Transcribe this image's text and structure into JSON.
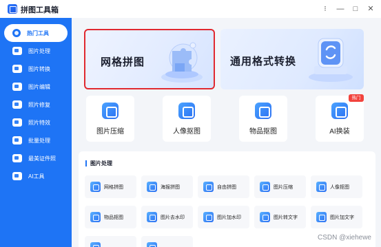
{
  "window": {
    "title": "拼图工具箱",
    "controls": [
      "⁝",
      "—",
      "□",
      "✕"
    ]
  },
  "sidebar": {
    "items": [
      {
        "label": "热门工具",
        "active": true
      },
      {
        "label": "图片处理"
      },
      {
        "label": "图片转换"
      },
      {
        "label": "图片编辑"
      },
      {
        "label": "照片修复"
      },
      {
        "label": "照片特效"
      },
      {
        "label": "批量处理"
      },
      {
        "label": "最美证件照"
      },
      {
        "label": "AI工具"
      }
    ]
  },
  "banners": [
    {
      "label": "网格拼图",
      "selected": true
    },
    {
      "label": "通用格式转换"
    }
  ],
  "tools": [
    {
      "label": "图片压缩"
    },
    {
      "label": "人像抠图"
    },
    {
      "label": "物品抠图"
    },
    {
      "label": "AI换装"
    }
  ],
  "hot_badge": "热门",
  "section": {
    "title": "图片处理",
    "items": [
      {
        "label": "网格拼图"
      },
      {
        "label": "海报拼图"
      },
      {
        "label": "自由拼图"
      },
      {
        "label": "图片压缩"
      },
      {
        "label": "人像抠图"
      },
      {
        "label": "物品抠图"
      },
      {
        "label": "图片去水印"
      },
      {
        "label": "图片加水印"
      },
      {
        "label": "图片转文字"
      },
      {
        "label": "图片加文字"
      }
    ]
  },
  "watermark": "CSDN @xiehewe",
  "colors": {
    "accent": "#1e74f5",
    "highlight_border": "#e0282e",
    "badge": "#f2433d"
  }
}
